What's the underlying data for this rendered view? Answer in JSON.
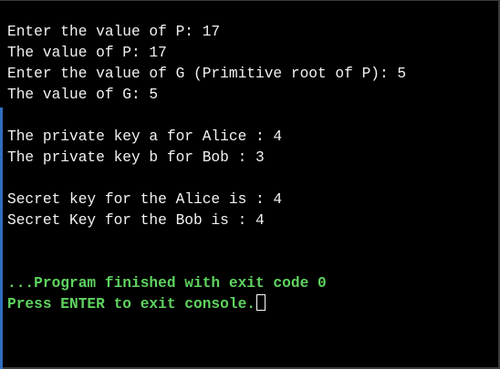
{
  "console": {
    "output_lines": [
      "Enter the value of P: 17",
      "The value of P: 17",
      "Enter the value of G (Primitive root of P): 5",
      "The value of G: 5",
      "",
      "The private key a for Alice : 4",
      "The private key b for Bob : 3",
      "",
      "Secret key for the Alice is : 4",
      "Secret Key for the Bob is : 4",
      "",
      ""
    ],
    "finished_message": "...Program finished with exit code 0",
    "exit_prompt": "Press ENTER to exit console."
  },
  "colors": {
    "background": "#000000",
    "text": "#f2f2f2",
    "finish_text": "#5fd35f",
    "accent_bar": "#2f6fbf"
  }
}
